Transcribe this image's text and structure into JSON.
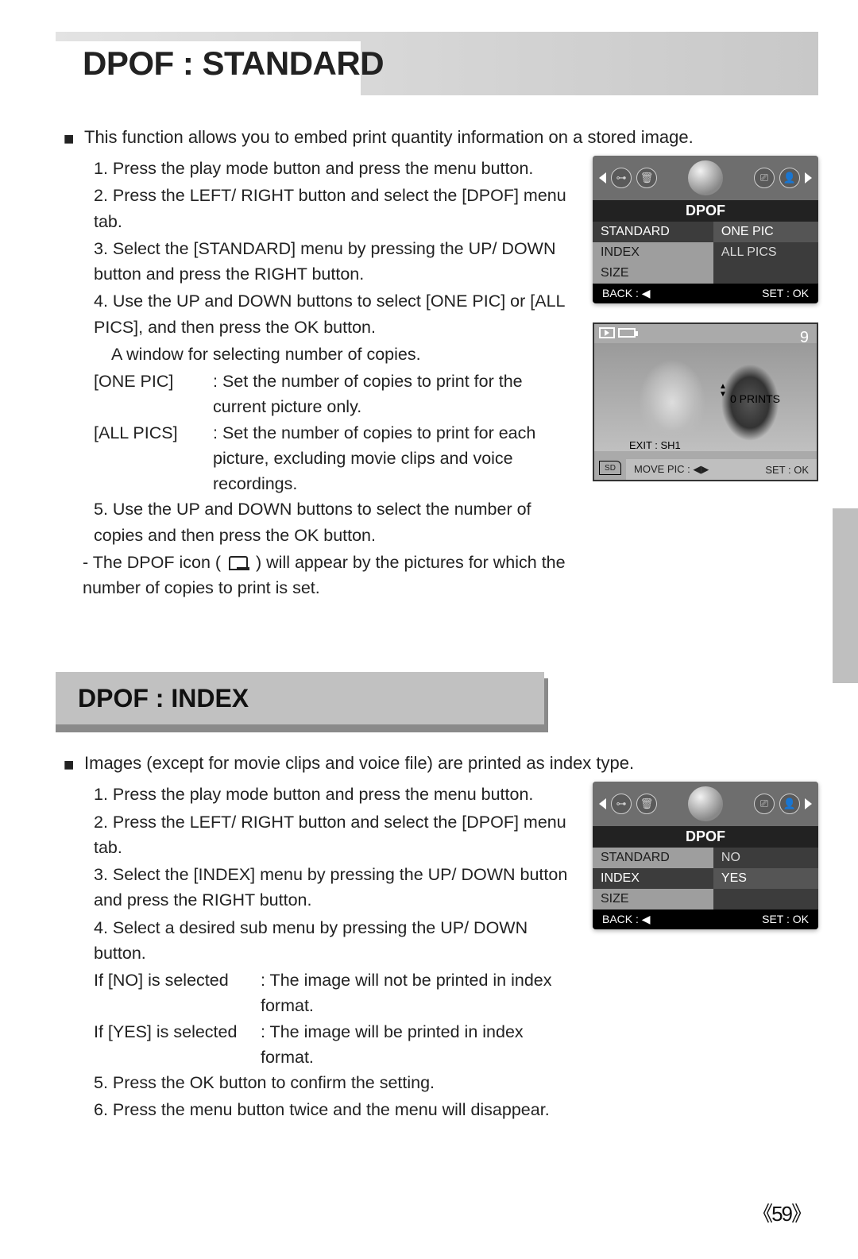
{
  "section1": {
    "title": "DPOF : STANDARD",
    "intro": "This function allows you to embed print quantity information on a stored image.",
    "steps": [
      "1. Press the play mode button and press the menu button.",
      "2. Press the LEFT/ RIGHT button and select the [DPOF] menu tab.",
      "3. Select the [STANDARD] menu by pressing the UP/ DOWN button and press the RIGHT button.",
      "4. Use the UP and DOWN buttons to select [ONE PIC] or [ALL PICS], and then press the OK button."
    ],
    "step4_note": "A window for selecting number of copies.",
    "options": [
      {
        "label": "[ONE PIC]",
        "text": ": Set the number of copies to print for the current picture only."
      },
      {
        "label": "[ALL PICS]",
        "text": ": Set the number of copies to print for each picture, excluding movie clips and voice recordings."
      }
    ],
    "step5": "5. Use the UP and DOWN buttons to select the number of copies and then press the OK button.",
    "dash_note_a": "- The DPOF icon (",
    "dash_note_b": ") will appear by the pictures for which the number of copies to print is set."
  },
  "menu1": {
    "title": "DPOF",
    "left": [
      "STANDARD",
      "INDEX",
      "SIZE"
    ],
    "right": [
      "ONE PIC",
      "ALL PICS"
    ],
    "back": "BACK :",
    "set": "SET : OK"
  },
  "preview": {
    "count": "9",
    "prints": "0 PRINTS",
    "exit": "EXIT : SH1",
    "sd": "SD",
    "move": "MOVE PIC : ◀▶",
    "set": "SET : OK"
  },
  "section2": {
    "title": "DPOF : INDEX",
    "intro": "Images (except for movie clips and voice file) are printed as index type.",
    "steps": [
      "1. Press the play mode button and press the menu button.",
      "2. Press the LEFT/ RIGHT button and select the [DPOF] menu tab.",
      "3. Select the [INDEX] menu by pressing the UP/ DOWN button and press the RIGHT button.",
      "4. Select a desired sub menu by pressing the UP/ DOWN button."
    ],
    "options": [
      {
        "label": "If [NO] is selected",
        "text": ": The image will  not be printed in index format."
      },
      {
        "label": "If [YES] is selected",
        "text": ": The image will be printed in index format."
      }
    ],
    "step5": "5. Press the OK button to confirm the setting.",
    "step6": "6. Press the menu button twice and the menu will disappear."
  },
  "menu2": {
    "title": "DPOF",
    "left": [
      "STANDARD",
      "INDEX",
      "SIZE"
    ],
    "right": [
      "NO",
      "YES"
    ],
    "back": "BACK :",
    "set": "SET : OK"
  },
  "page_number": "《59》",
  "icon_glyphs": {
    "key": "⊶",
    "trash": "🗑",
    "tag": "⎚",
    "person": "👤"
  }
}
